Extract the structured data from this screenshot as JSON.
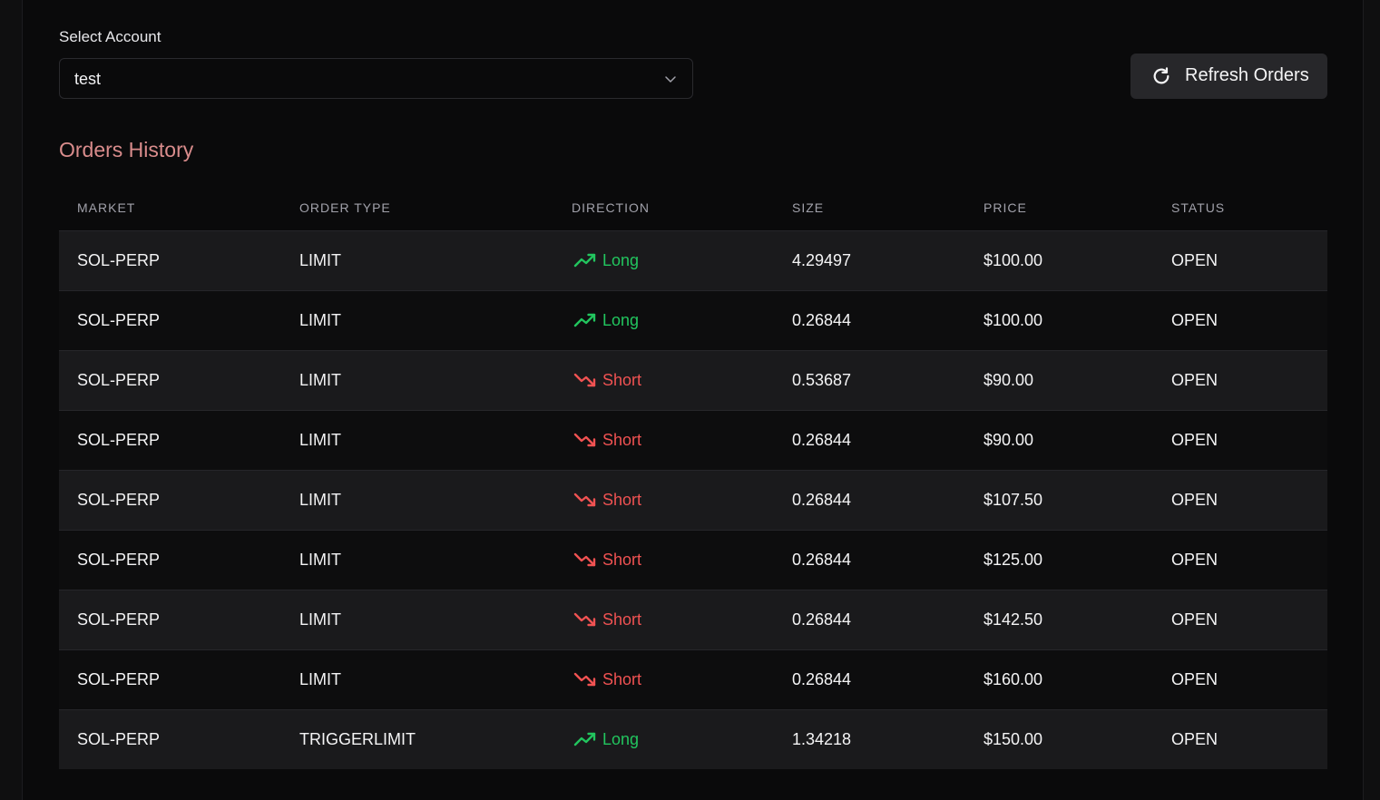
{
  "account": {
    "label": "Select Account",
    "selected": "test"
  },
  "refresh_button": {
    "label": "Refresh Orders",
    "icon": "refresh-icon"
  },
  "orders": {
    "title": "Orders History",
    "columns": [
      "MARKET",
      "ORDER TYPE",
      "DIRECTION",
      "SIZE",
      "PRICE",
      "STATUS"
    ],
    "rows": [
      {
        "market": "SOL-PERP",
        "order_type": "LIMIT",
        "direction": "Long",
        "size": "4.29497",
        "price": "$100.00",
        "status": "OPEN"
      },
      {
        "market": "SOL-PERP",
        "order_type": "LIMIT",
        "direction": "Long",
        "size": "0.26844",
        "price": "$100.00",
        "status": "OPEN"
      },
      {
        "market": "SOL-PERP",
        "order_type": "LIMIT",
        "direction": "Short",
        "size": "0.53687",
        "price": "$90.00",
        "status": "OPEN"
      },
      {
        "market": "SOL-PERP",
        "order_type": "LIMIT",
        "direction": "Short",
        "size": "0.26844",
        "price": "$90.00",
        "status": "OPEN"
      },
      {
        "market": "SOL-PERP",
        "order_type": "LIMIT",
        "direction": "Short",
        "size": "0.26844",
        "price": "$107.50",
        "status": "OPEN"
      },
      {
        "market": "SOL-PERP",
        "order_type": "LIMIT",
        "direction": "Short",
        "size": "0.26844",
        "price": "$125.00",
        "status": "OPEN"
      },
      {
        "market": "SOL-PERP",
        "order_type": "LIMIT",
        "direction": "Short",
        "size": "0.26844",
        "price": "$142.50",
        "status": "OPEN"
      },
      {
        "market": "SOL-PERP",
        "order_type": "LIMIT",
        "direction": "Short",
        "size": "0.26844",
        "price": "$160.00",
        "status": "OPEN"
      },
      {
        "market": "SOL-PERP",
        "order_type": "TRIGGERLIMIT",
        "direction": "Long",
        "size": "1.34218",
        "price": "$150.00",
        "status": "OPEN"
      }
    ]
  },
  "colors": {
    "long": "#22c55e",
    "short": "#f05252",
    "title_accent": "#d98c8c"
  }
}
